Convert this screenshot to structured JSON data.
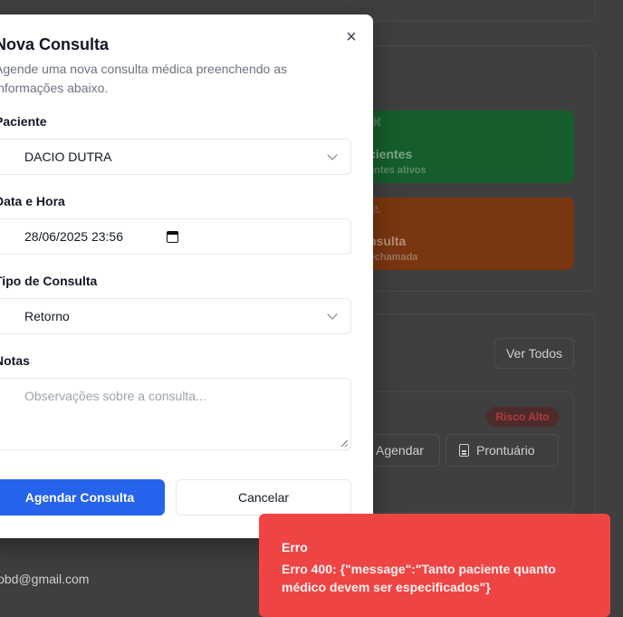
{
  "background": {
    "stat_cards": [
      {
        "title": "cientes",
        "subtitle": "entes ativos",
        "icon": "users-icon",
        "color": "#155e2b"
      },
      {
        "title": "nsulta",
        "subtitle": "ochamada",
        "icon": "alert-icon",
        "color": "#7a3610"
      }
    ],
    "ver_todos_label": "Ver Todos",
    "risk_badge": "Risco Alto",
    "agendar_label": "Agendar",
    "prontuario_label": "Prontuário",
    "email": "iobd@gmail.com"
  },
  "dialog": {
    "title": "Nova Consulta",
    "description": "Agende uma nova consulta médica preenchendo as informações abaixo.",
    "fields": {
      "paciente": {
        "label": "Paciente",
        "value": "DACIO DUTRA"
      },
      "data_hora": {
        "label": "Data e Hora",
        "value": "28/06/2025 23:56"
      },
      "tipo": {
        "label": "Tipo de Consulta",
        "value": "Retorno"
      },
      "notas": {
        "label": "Notas",
        "placeholder": "Observações sobre a consulta..."
      }
    },
    "submit_label": "Agendar Consulta",
    "cancel_label": "Cancelar",
    "close_symbol": "×"
  },
  "toast": {
    "title": "Erro",
    "message": "Erro 400: {\"message\":\"Tanto paciente quanto médico devem ser especificados\"}",
    "color": "#ef4444"
  }
}
